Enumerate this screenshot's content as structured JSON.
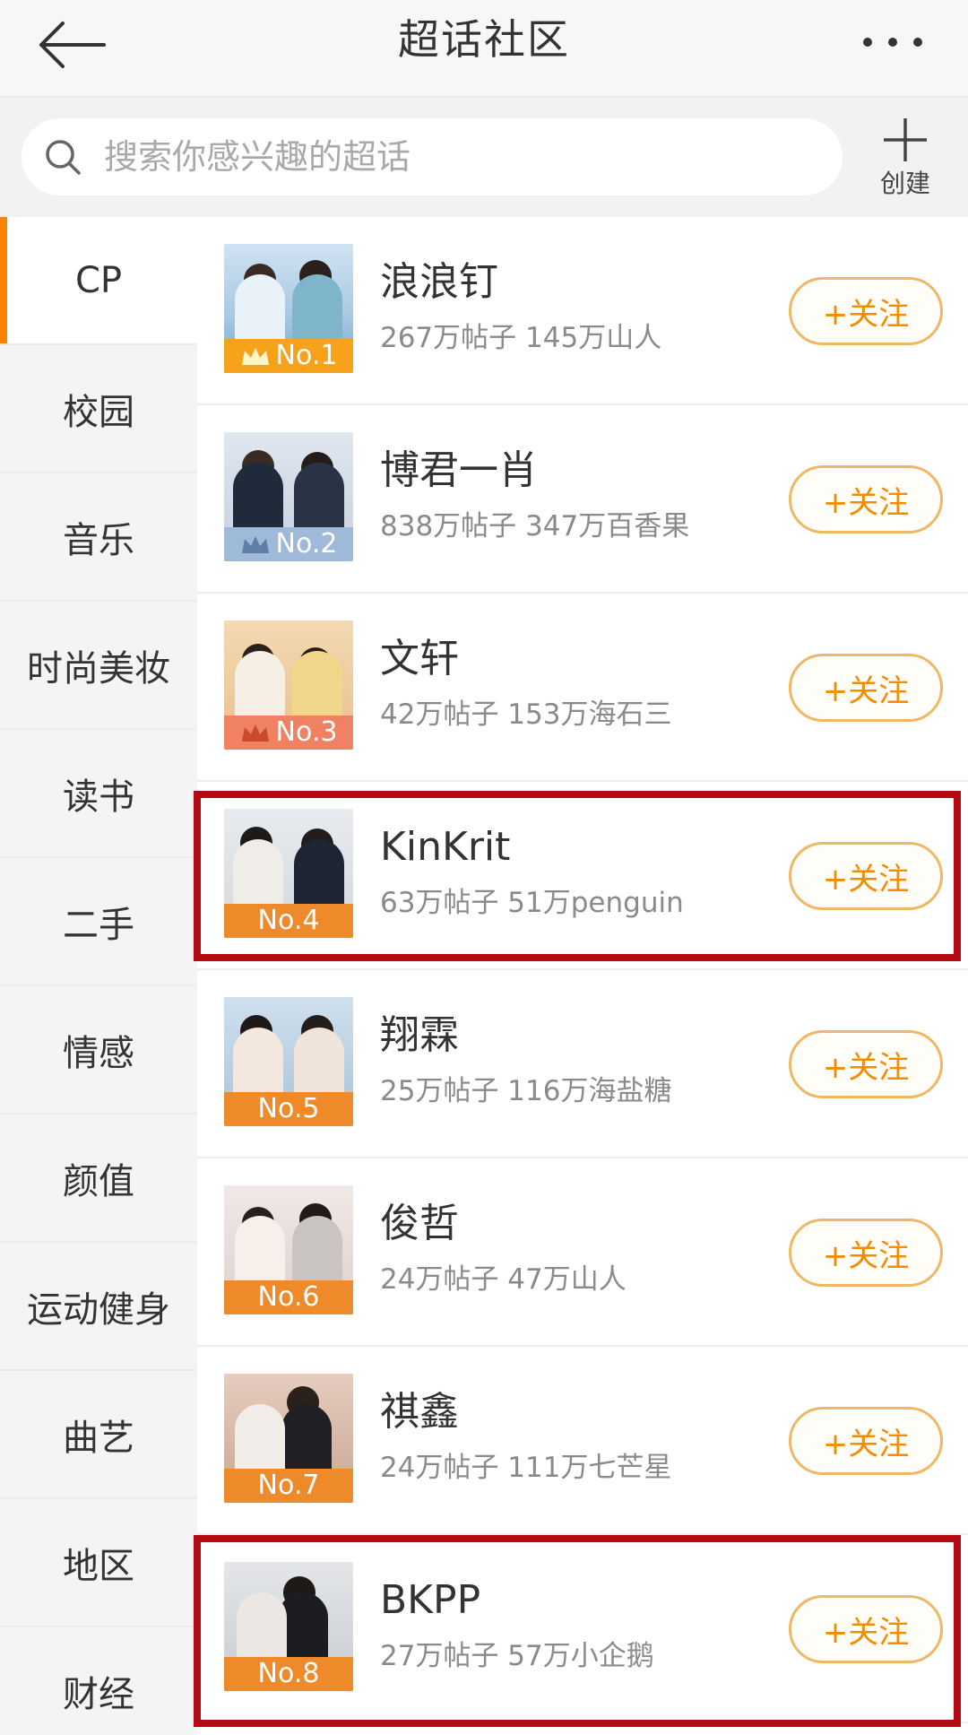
{
  "header": {
    "title": "超话社区"
  },
  "search": {
    "placeholder": "搜索你感兴趣的超话",
    "create_label": "创建"
  },
  "sidebar": {
    "items": [
      {
        "label": "CP",
        "active": true
      },
      {
        "label": "校园"
      },
      {
        "label": "音乐"
      },
      {
        "label": "时尚美妆"
      },
      {
        "label": "读书"
      },
      {
        "label": "二手"
      },
      {
        "label": "情感"
      },
      {
        "label": "颜值"
      },
      {
        "label": "运动健身"
      },
      {
        "label": "曲艺"
      },
      {
        "label": "地区"
      },
      {
        "label": "财经"
      }
    ]
  },
  "list": {
    "follow_label": "+关注",
    "items": [
      {
        "rank": "No.1",
        "name": "浪浪钉",
        "stats": "267万帖子 145万山人",
        "crown": true,
        "badge_color": "#f7a21b"
      },
      {
        "rank": "No.2",
        "name": "博君一肖",
        "stats": "838万帖子 347万百香果",
        "crown": true,
        "badge_color": "#9fb9d8"
      },
      {
        "rank": "No.3",
        "name": "文轩",
        "stats": "42万帖子 153万海石三",
        "crown": true,
        "badge_color": "#f08162"
      },
      {
        "rank": "No.4",
        "name": "KinKrit",
        "stats": "63万帖子 51万penguin",
        "crown": false,
        "badge_color": "#ef8a2a"
      },
      {
        "rank": "No.5",
        "name": "翔霖",
        "stats": "25万帖子 116万海盐糖",
        "crown": false,
        "badge_color": "#ef8a2a"
      },
      {
        "rank": "No.6",
        "name": "俊哲",
        "stats": "24万帖子 47万山人",
        "crown": false,
        "badge_color": "#ef8a2a"
      },
      {
        "rank": "No.7",
        "name": "祺鑫",
        "stats": "24万帖子 111万七芒星",
        "crown": false,
        "badge_color": "#ef8a2a"
      },
      {
        "rank": "No.8",
        "name": "BKPP",
        "stats": "27万帖子 57万小企鹅",
        "crown": false,
        "badge_color": "#ef8a2a"
      }
    ]
  },
  "colors": {
    "accent": "#ff8200",
    "follow_text": "#f28c00",
    "highlight": "#b40a14"
  }
}
